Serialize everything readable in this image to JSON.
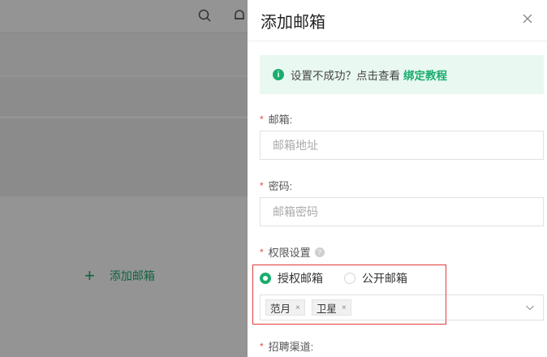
{
  "drawer": {
    "title": "添加邮箱",
    "alert": {
      "text": "设置不成功？点击查看",
      "link": "绑定教程"
    },
    "fields": {
      "email": {
        "label": "邮箱:",
        "placeholder": "邮箱地址",
        "value": ""
      },
      "password": {
        "label": "密码:",
        "placeholder": "邮箱密码",
        "value": ""
      },
      "permission": {
        "label": "权限设置",
        "options": [
          {
            "label": "授权邮箱",
            "checked": true
          },
          {
            "label": "公开邮箱",
            "checked": false
          }
        ],
        "selected_tags": [
          "范月",
          "卫星"
        ]
      },
      "channel": {
        "label": "招聘渠道:"
      }
    }
  },
  "background": {
    "add_mailbox_label": "添加邮箱"
  },
  "colors": {
    "accent": "#1aad6e",
    "required": "#e74c3c",
    "highlight": "#e23b3b",
    "alert_bg": "#e9f8f1"
  }
}
